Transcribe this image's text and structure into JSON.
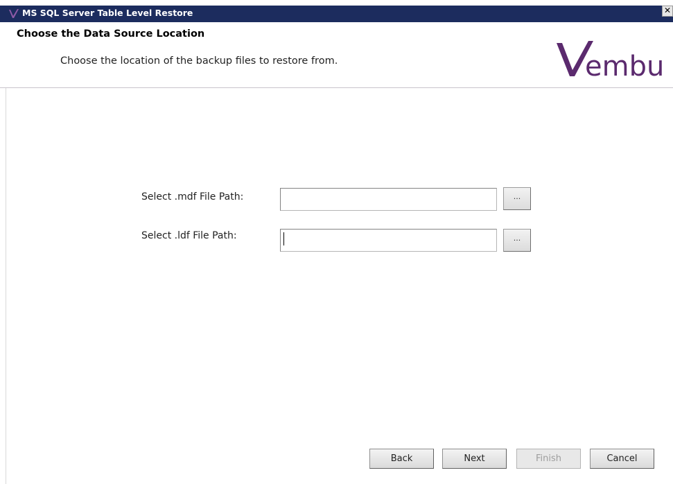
{
  "window": {
    "title": "MS SQL Server Table Level Restore",
    "close_glyph": "✕",
    "logo_icon": "vembu-v-icon"
  },
  "header": {
    "title": "Choose the Data Source Location",
    "subtitle": "Choose the location of the backup files to restore from.",
    "brand_text": "embu",
    "brand_color": "#5b2a6e"
  },
  "form": {
    "mdf": {
      "label": "Select .mdf File Path:",
      "value": "",
      "browse_label": "..."
    },
    "ldf": {
      "label": "Select .ldf File Path:",
      "value": "",
      "browse_label": "..."
    }
  },
  "footer": {
    "back": "Back",
    "next": "Next",
    "finish": "Finish",
    "cancel": "Cancel"
  },
  "colors": {
    "titlebar": "#1c2c5e",
    "brand": "#5b2a6e"
  }
}
